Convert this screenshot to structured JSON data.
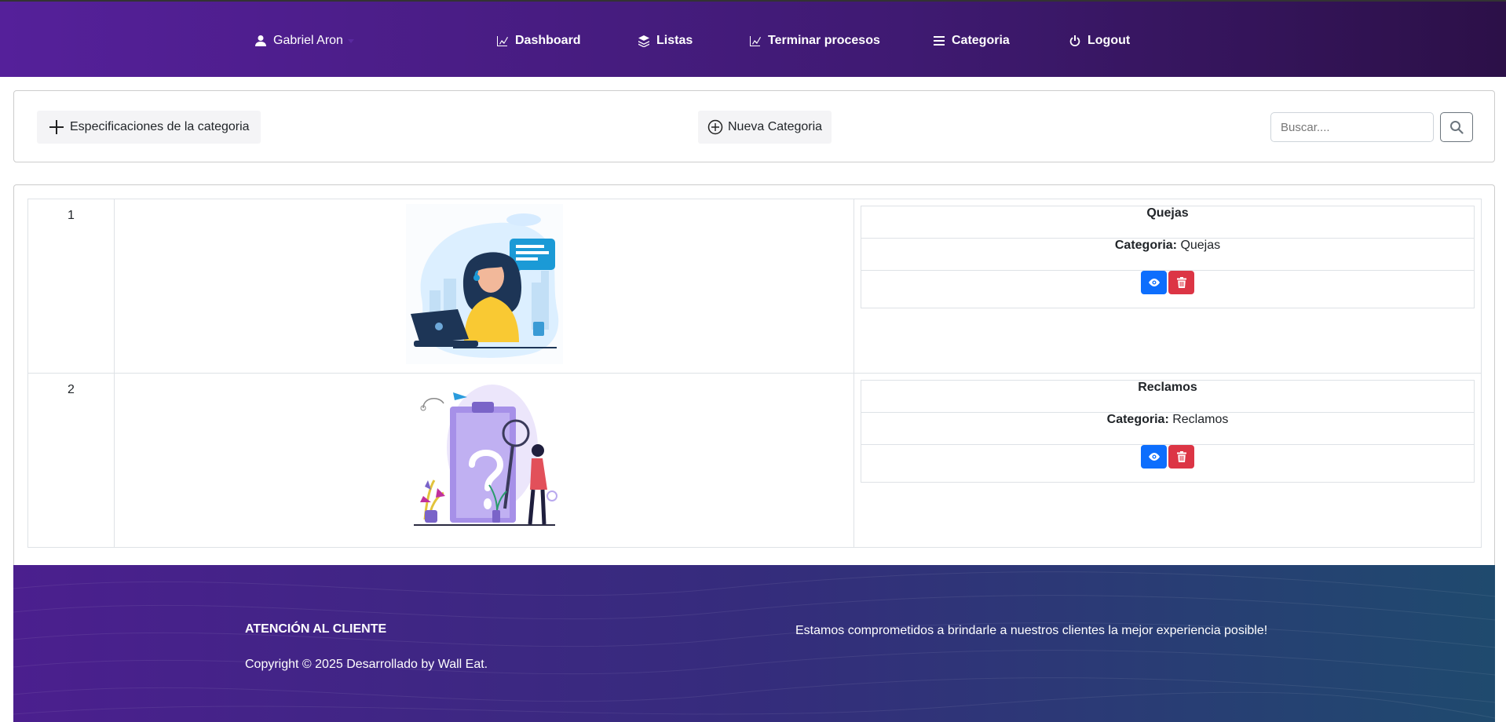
{
  "nav": {
    "user": "Gabriel Aron",
    "items": [
      {
        "label": "Dashboard",
        "icon": "chart-icon"
      },
      {
        "label": "Listas",
        "icon": "layers-icon"
      },
      {
        "label": "Terminar procesos",
        "icon": "chart-icon"
      },
      {
        "label": "Categoria",
        "icon": "menu-icon"
      },
      {
        "label": "Logout",
        "icon": "power-icon"
      }
    ]
  },
  "toolbar": {
    "spec_label": "Especificaciones de la categoria",
    "new_label": "Nueva Categoria",
    "search_placeholder": "Buscar...."
  },
  "table": {
    "rows": [
      {
        "num": "1",
        "title": "Quejas",
        "cat_label": "Categoria:",
        "cat_value": "Quejas",
        "image": "customer-support-illustration"
      },
      {
        "num": "2",
        "title": "Reclamos",
        "cat_label": "Categoria:",
        "cat_value": "Reclamos",
        "image": "question-clipboard-illustration"
      }
    ]
  },
  "footer": {
    "title": "ATENCIÓN AL CLIENTE",
    "copyright": "Copyright © 2025 Desarrollado by Wall Eat.",
    "message": "Estamos comprometidos a brindarle a nuestros clientes la mejor experiencia posible!"
  },
  "colors": {
    "nav_bg": "#4a1c86",
    "view_btn": "#0d6efd",
    "delete_btn": "#dc3545",
    "footer_bg": "#352c7c"
  }
}
